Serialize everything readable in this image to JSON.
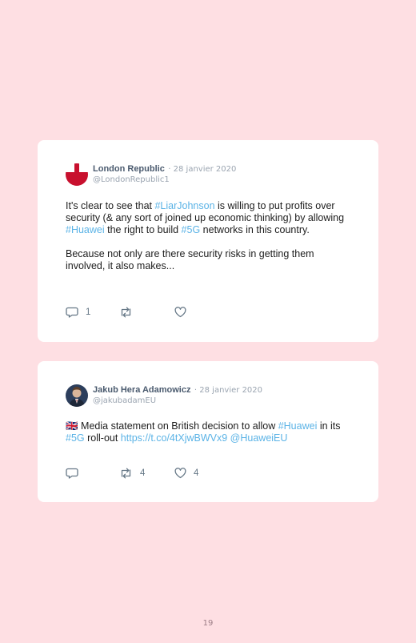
{
  "tweets": [
    {
      "author_name": "London Republic",
      "date": "· 28 janvier 2020",
      "handle": "@LondonRepublic1",
      "paragraphs": [
        [
          {
            "t": "It's clear to see that ",
            "link": false
          },
          {
            "t": "#LiarJohnson",
            "link": true
          },
          {
            "t": " is willing to put profits over security (& any sort of joined up economic thinking) by allowing ",
            "link": false
          },
          {
            "t": "#Huawei",
            "link": true
          },
          {
            "t": " the right to build ",
            "link": false
          },
          {
            "t": "#5G",
            "link": true
          },
          {
            "t": " networks in this country.",
            "link": false
          }
        ],
        [
          {
            "t": "Because not only are there security risks in getting them involved, it also makes...",
            "link": false
          }
        ]
      ],
      "replies": "1",
      "retweets": "",
      "likes": ""
    },
    {
      "author_name": "Jakub Hera Adamowicz",
      "date": "· 28 janvier 2020",
      "handle": "@jakubadamEU",
      "paragraphs": [
        [
          {
            "t": "🇬🇧 ",
            "link": false,
            "flag": true
          },
          {
            "t": "Media statement on British decision to allow ",
            "link": false
          },
          {
            "t": "#Huawei",
            "link": true
          },
          {
            "t": " in its ",
            "link": false
          },
          {
            "t": "#5G",
            "link": true
          },
          {
            "t": " roll-out ",
            "link": false
          },
          {
            "t": "https://t.co/4tXjwBWVx9",
            "link": true
          },
          {
            "t": " ",
            "link": false
          },
          {
            "t": "@HuaweiEU",
            "link": true
          }
        ]
      ],
      "replies": "",
      "retweets": "4",
      "likes": "4"
    }
  ],
  "colors": {
    "background": "#fedfe3",
    "link": "#5bb3e6",
    "icon": "#657786"
  },
  "icons": {
    "reply": "reply-icon",
    "retweet": "retweet-icon",
    "like": "heart-icon"
  },
  "page_number": "19"
}
